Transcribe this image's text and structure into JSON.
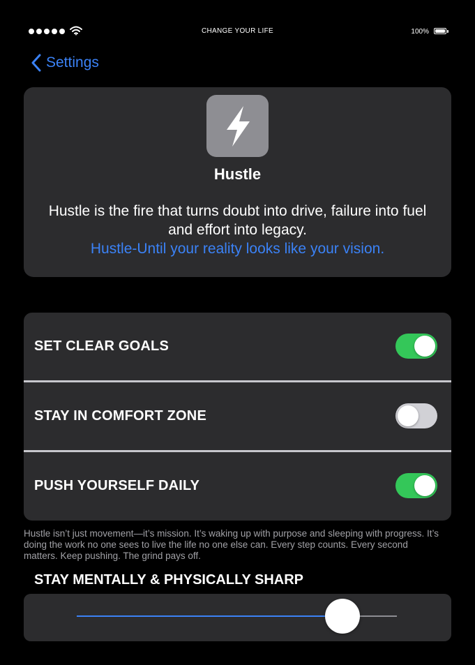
{
  "status_bar": {
    "title": "CHANGE YOUR LIFE",
    "battery": "100%",
    "signal_icon": "signal-dots-icon",
    "wifi_icon": "wifi-icon",
    "battery_icon": "battery-icon"
  },
  "nav": {
    "back_label": "Settings",
    "back_icon": "chevron-left-icon"
  },
  "header": {
    "icon": "lightning-bolt-icon",
    "app_name": "Hustle",
    "description": "Hustle is the fire that turns doubt into drive, failure into fuel and effort into legacy.",
    "tagline": "Hustle-Until your reality looks like your vision."
  },
  "settings": [
    {
      "label": "SET CLEAR GOALS",
      "enabled": true
    },
    {
      "label": "STAY IN COMFORT ZONE",
      "enabled": false
    },
    {
      "label": "PUSH YOURSELF DAILY",
      "enabled": true
    }
  ],
  "footer_text": "Hustle isn’t just movement—it’s mission. It’s waking up with purpose and sleeping with progress. It’s doing the work no one sees to live the life no one else can. Every step counts. Every second matters. Keep pushing. The grind pays off.",
  "slider": {
    "label": "STAY MENTALLY & PHYSICALLY SHARP",
    "value": 0.83
  },
  "colors": {
    "accent": "#3b82f6",
    "toggle_on": "#34c759",
    "toggle_off": "#d1d1d6",
    "card": "#2c2c2e"
  }
}
